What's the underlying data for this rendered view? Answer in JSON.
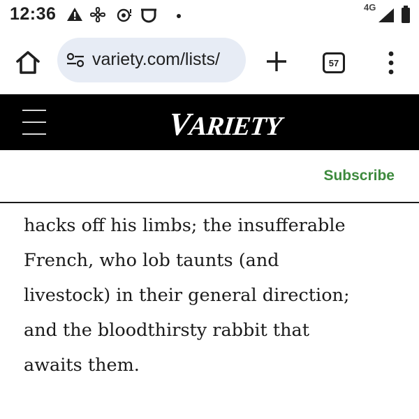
{
  "status_bar": {
    "time": "12:36",
    "network": "4G",
    "icons": [
      "warning-icon",
      "fan-icon",
      "podcast-icon",
      "hotspot-icon",
      "dot-icon",
      "signal-icon",
      "battery-icon"
    ]
  },
  "browser": {
    "url": "variety.com/lists/",
    "tab_count": "57",
    "url_pill_color": "#e7ecf5"
  },
  "site": {
    "logo_first": "V",
    "logo_rest": "ARIETY",
    "subscribe_label": "Subscribe",
    "subscribe_color": "#3d8a3d"
  },
  "article": {
    "lines": [
      "hacks off his limbs; the insufferable",
      "French, who lob taunts (and",
      "livestock) in their general direction;",
      "and the bloodthirsty rabbit that",
      "awaits them."
    ]
  }
}
